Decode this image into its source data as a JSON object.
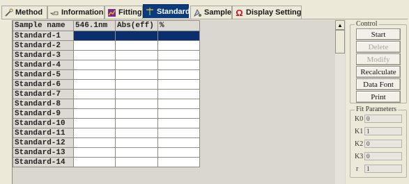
{
  "tabs": [
    {
      "label": "Method",
      "icon": "wand-icon"
    },
    {
      "label": "Information",
      "icon": "pointing-hand-icon"
    },
    {
      "label": "Fitting",
      "icon": "chart-icon"
    },
    {
      "label": "Standard",
      "icon": "standard-icon",
      "active": true
    },
    {
      "label": "Sample",
      "icon": "sample-icon"
    },
    {
      "label": "Display Setting",
      "icon": "omega-icon"
    }
  ],
  "grid": {
    "headers": [
      "Sample name",
      "546.1nm",
      "Abs(eff)",
      "%"
    ],
    "rows": [
      "Standard-1",
      "Standard-2",
      "Standard-3",
      "Standard-4",
      "Standard-5",
      "Standard-6",
      "Standard-7",
      "Standard-8",
      "Standard-9",
      "Standard-10",
      "Standard-11",
      "Standard-12",
      "Standard-13",
      "Standard-14"
    ],
    "selected_row": 0
  },
  "control": {
    "label": "Control",
    "buttons": [
      {
        "label": "Start",
        "enabled": true
      },
      {
        "label": "Delete",
        "enabled": false
      },
      {
        "label": "Modify",
        "enabled": false
      },
      {
        "label": "Recalculate",
        "enabled": true
      },
      {
        "label": "Data Font",
        "enabled": true
      },
      {
        "label": "Print",
        "enabled": true
      }
    ]
  },
  "fit_parameters": {
    "label": "Fit Parameters",
    "params": [
      {
        "name": "K0",
        "value": "0"
      },
      {
        "name": "K1",
        "value": "1"
      },
      {
        "name": "K2",
        "value": "0"
      },
      {
        "name": "K3",
        "value": "0"
      },
      {
        "name": "r",
        "value": "1"
      }
    ]
  },
  "colors": {
    "active_tab": "#0b3a7e",
    "selection": "#0a2e6e",
    "window_bg": "#ece9d8"
  }
}
